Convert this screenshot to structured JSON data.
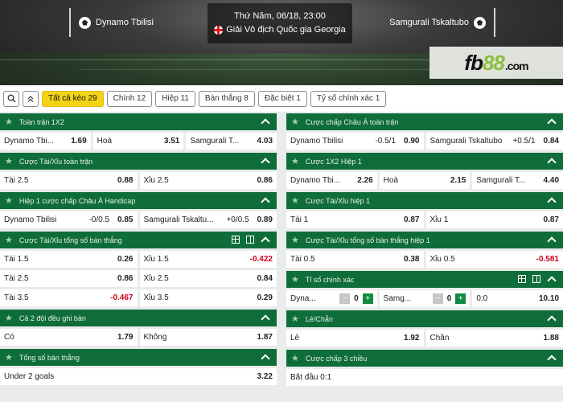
{
  "match": {
    "home": "Dynamo Tbilisi",
    "away": "Samgurali Tskaltubo",
    "datetime": "Thứ Năm, 06/18, 23:00",
    "league": "Giải Vô địch Quốc gia Georgia"
  },
  "brand": {
    "fb": "fb",
    "num": "88",
    "com": ".com"
  },
  "tabs": [
    {
      "label": "Tất cả kèo 29",
      "active": true
    },
    {
      "label": "Chính 12"
    },
    {
      "label": "Hiệp 11"
    },
    {
      "label": "Bàn thắng 8"
    },
    {
      "label": "Đặc biệt 1"
    },
    {
      "label": "Tỷ số chính xác 1"
    }
  ],
  "icons": {
    "search": "search-icon",
    "collapse": "double-chevron-up-icon",
    "star": "star-icon"
  },
  "colors": {
    "header_green": "#0f6d3a",
    "active_tab": "#f4d315",
    "negative": "#d0021b"
  },
  "left": [
    {
      "title": "Toàn trận 1X2",
      "rows": [
        [
          {
            "l": "Dynamo Tbi...",
            "o": "1.69"
          },
          {
            "l": "Hoà",
            "o": "3.51"
          },
          {
            "l": "Samgurali T...",
            "o": "4.03"
          }
        ]
      ]
    },
    {
      "title": "Cược Tài/Xỉu toàn trận",
      "rows": [
        [
          {
            "l": "Tài 2.5",
            "o": "0.88"
          },
          {
            "l": "Xỉu 2.5",
            "o": "0.86"
          }
        ]
      ]
    },
    {
      "title": "Hiệp 1 cược chấp Châu Á Handicap",
      "rows": [
        [
          {
            "l": "Dynamo Tbilisi",
            "h": "-0/0.5",
            "o": "0.85"
          },
          {
            "l": "Samgurali Tskaltu...",
            "h": "+0/0.5",
            "o": "0.89"
          }
        ]
      ]
    },
    {
      "title": "Cược Tài/Xỉu tổng số bàn thắng",
      "rows": [
        [
          {
            "l": "Tài 1.5",
            "o": "0.26"
          },
          {
            "l": "Xỉu 1.5",
            "o": "-0.422"
          }
        ],
        [
          {
            "l": "Tài 2.5",
            "o": "0.86"
          },
          {
            "l": "Xỉu 2.5",
            "o": "0.84"
          }
        ],
        [
          {
            "l": "Tài 3.5",
            "o": "-0.467"
          },
          {
            "l": "Xỉu 3.5",
            "o": "0.29"
          }
        ]
      ]
    },
    {
      "title": "Cả 2 đội đều ghi bàn",
      "rows": [
        [
          {
            "l": "Có",
            "o": "1.79"
          },
          {
            "l": "Không",
            "o": "1.87"
          }
        ]
      ]
    },
    {
      "title": "Tổng số bàn thắng",
      "rows": [
        [
          {
            "l": "Under 2 goals",
            "o": "3.22"
          }
        ]
      ]
    }
  ],
  "right": [
    {
      "title": "Cược chấp Châu Á toàn trận",
      "rows": [
        [
          {
            "l": "Dynamo Tbilisi",
            "h": "-0.5/1",
            "o": "0.90"
          },
          {
            "l": "Samgurali Tskaltubo",
            "h": "+0.5/1",
            "o": "0.84"
          }
        ]
      ]
    },
    {
      "title": "Cược 1X2 Hiệp 1",
      "rows": [
        [
          {
            "l": "Dynamo Tbi...",
            "o": "2.26"
          },
          {
            "l": "Hoà",
            "o": "2.15"
          },
          {
            "l": "Samgurali T...",
            "o": "4.40"
          }
        ]
      ]
    },
    {
      "title": "Cược Tài/Xỉu hiệp 1",
      "rows": [
        [
          {
            "l": "Tài 1",
            "o": "0.87"
          },
          {
            "l": "Xỉu 1",
            "o": "0.87"
          }
        ]
      ]
    },
    {
      "title": "Cược Tài/Xỉu tổng số bàn thắng hiệp 1",
      "rows": [
        [
          {
            "l": "Tài 0.5",
            "o": "0.38"
          },
          {
            "l": "Xỉu 0.5",
            "o": "-0.581"
          }
        ]
      ]
    },
    {
      "title": "Tỉ số chính xác",
      "score": {
        "home": "Dyna...",
        "home_val": "0",
        "away": "Samg...",
        "away_val": "0",
        "result": "0:0",
        "odd": "10.10",
        "minus": "−",
        "plus": "+"
      }
    },
    {
      "title": "Lẻ/Chẵn",
      "rows": [
        [
          {
            "l": "Lẻ",
            "o": "1.92"
          },
          {
            "l": "Chẵn",
            "o": "1.88"
          }
        ]
      ]
    },
    {
      "title": "Cược chấp 3 chiều",
      "rows": [
        [
          {
            "l": "Bắt đầu 0:1",
            "o": ""
          }
        ]
      ]
    }
  ]
}
